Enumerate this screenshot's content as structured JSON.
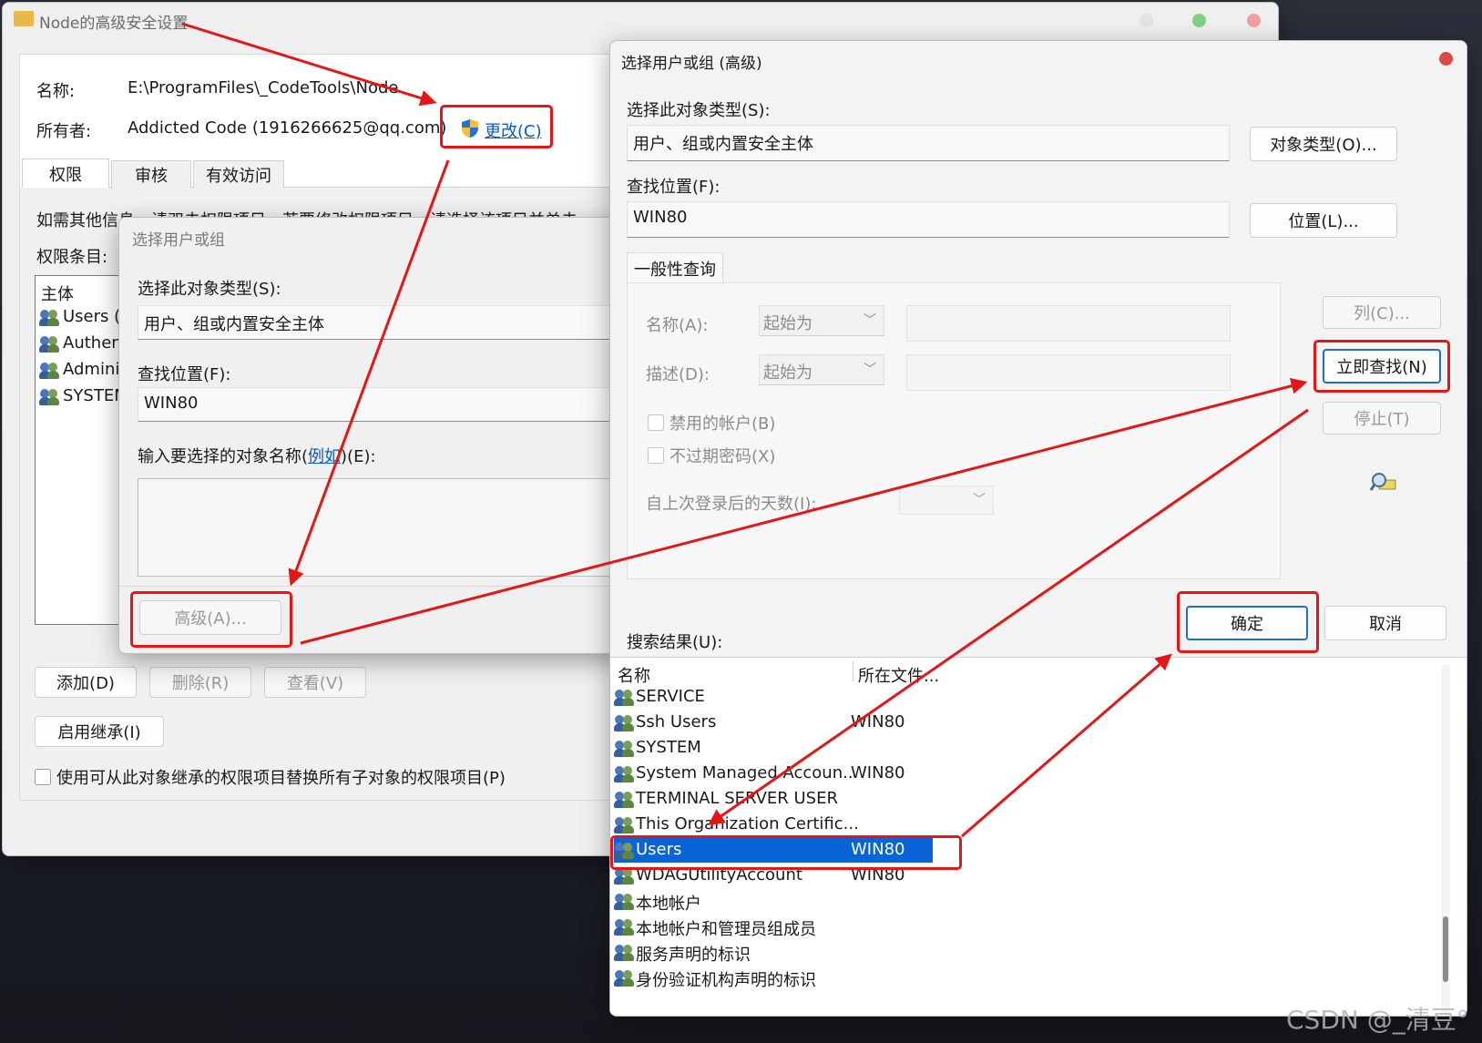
{
  "security_window": {
    "title": "Node的高级安全设置",
    "name_label": "名称:",
    "name_value": "E:\\ProgramFiles\\_CodeTools\\Node",
    "owner_label": "所有者:",
    "owner_value": "Addicted Code (1916266625@qq.com)",
    "change_link": "更改(C)",
    "tabs": [
      "权限",
      "审核",
      "有效访问"
    ],
    "info_text": "如需其他信息，请双击权限项目。若要修改权限项目，请选择该项目并单击",
    "entries_label": "权限条目:",
    "column_principal": "主体",
    "principals": [
      "Users (V",
      "Authen",
      "Adminis",
      "SYSTEM"
    ],
    "add_button": "添加(D)",
    "remove_button": "删除(R)",
    "view_button": "查看(V)",
    "inherit_button": "启用继承(I)",
    "replace_checkbox": "使用可从此对象继承的权限项目替换所有子对象的权限项目(P)"
  },
  "select_dialog": {
    "title": "选择用户或组",
    "object_type_label": "选择此对象类型(S):",
    "object_type_value": "用户、组或内置安全主体",
    "location_label": "查找位置(F):",
    "location_value": "WIN80",
    "enter_label_pre": "输入要选择的对象名称(",
    "enter_label_link": "例如",
    "enter_label_post": ")(E):",
    "advanced_button": "高级(A)..."
  },
  "advanced_dialog": {
    "title": "选择用户或组 (高级)",
    "object_type_label": "选择此对象类型(S):",
    "object_type_value": "用户、组或内置安全主体",
    "object_types_button": "对象类型(O)...",
    "location_label": "查找位置(F):",
    "location_value": "WIN80",
    "locations_button": "位置(L)...",
    "query_tab": "一般性查询",
    "name_label": "名称(A):",
    "name_mode": "起始为",
    "desc_label": "描述(D):",
    "desc_mode": "起始为",
    "disabled_accounts": "禁用的帐户(B)",
    "non_expiring": "不过期密码(X)",
    "days_label": "自上次登录后的天数(I):",
    "columns_button": "列(C)...",
    "find_now_button": "立即查找(N)",
    "stop_button": "停止(T)",
    "ok_button": "确定",
    "cancel_button": "取消",
    "results_label": "搜索结果(U):",
    "col_name": "名称",
    "col_folder": "所在文件...",
    "results": [
      {
        "name": "SERVICE",
        "folder": ""
      },
      {
        "name": "Ssh Users",
        "folder": "WIN80"
      },
      {
        "name": "SYSTEM",
        "folder": ""
      },
      {
        "name": "System Managed Accoun...",
        "folder": "WIN80"
      },
      {
        "name": "TERMINAL SERVER USER",
        "folder": ""
      },
      {
        "name": "This Organization Certific...",
        "folder": ""
      },
      {
        "name": "Users",
        "folder": "WIN80"
      },
      {
        "name": "WDAGUtilityAccount",
        "folder": "WIN80"
      },
      {
        "name": "本地帐户",
        "folder": ""
      },
      {
        "name": "本地帐户和管理员组成员",
        "folder": ""
      },
      {
        "name": "服务声明的标识",
        "folder": ""
      },
      {
        "name": "身份验证机构声明的标识",
        "folder": ""
      }
    ],
    "selected_result": "Users"
  },
  "watermark": "CSDN @_清豆°",
  "colors": {
    "annotation_red": "#e51616",
    "selection_blue": "#0a64d8",
    "link_blue": "#0a5bc4"
  }
}
